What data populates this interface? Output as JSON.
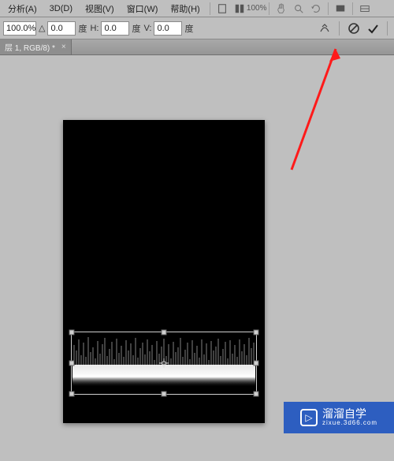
{
  "menu": {
    "analyze": "分析(A)",
    "threeD": "3D(D)",
    "view": "视图(V)",
    "window": "窗口(W)",
    "help": "帮助(H)",
    "zoom_pct": "100%"
  },
  "options": {
    "scale": "100.0%",
    "angle_value": "0.0",
    "angle_unit": "度",
    "h_value": "0.0",
    "h_label": "H:",
    "v_value": "0.0",
    "v_label": "V:",
    "angle_prefix": "△"
  },
  "tab": {
    "label": "层 1, RGB/8) *",
    "close": "×"
  },
  "icons": {
    "warp": "warp-icon",
    "cancel": "cancel-icon",
    "commit": "commit-icon"
  },
  "badge": {
    "title": "溜溜自学",
    "subtitle": "zixue.3d66.com",
    "play": "▷"
  }
}
